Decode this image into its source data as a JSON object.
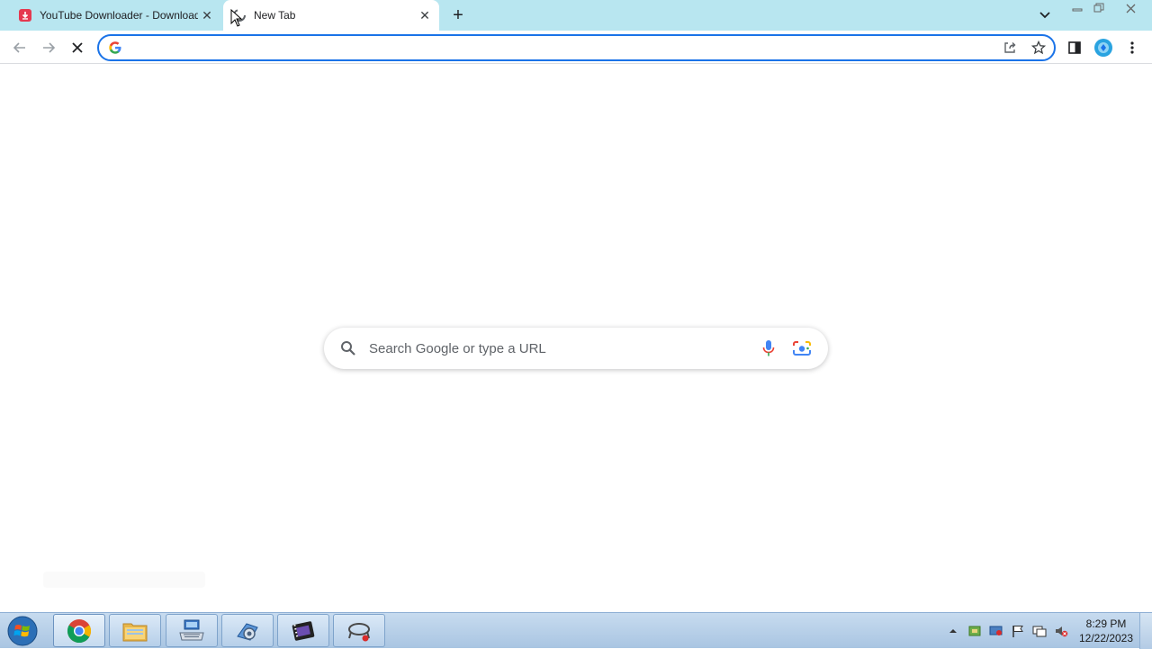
{
  "browser": {
    "tabs": [
      {
        "title": "YouTube Downloader - Download",
        "favicon": "download-icon",
        "active": false
      },
      {
        "title": "New Tab",
        "favicon": "loading-icon",
        "active": true
      }
    ],
    "new_tab_symbol": "+",
    "close_symbol": "✕"
  },
  "omnibox": {
    "value": "",
    "placeholder": ""
  },
  "ntp": {
    "search_placeholder": "Search Google or type a URL"
  },
  "taskbar": {
    "apps": [
      "chrome-icon",
      "file-explorer-icon",
      "keyboard-app-icon",
      "settings-app-icon",
      "video-editor-icon",
      "network-app-icon"
    ],
    "clock_time": "8:29 PM",
    "clock_date": "12/22/2023"
  },
  "colors": {
    "tabstrip": "#b8e6f0",
    "omnibox_border": "#1a73e8",
    "taskbar": "#a9c5e2"
  }
}
